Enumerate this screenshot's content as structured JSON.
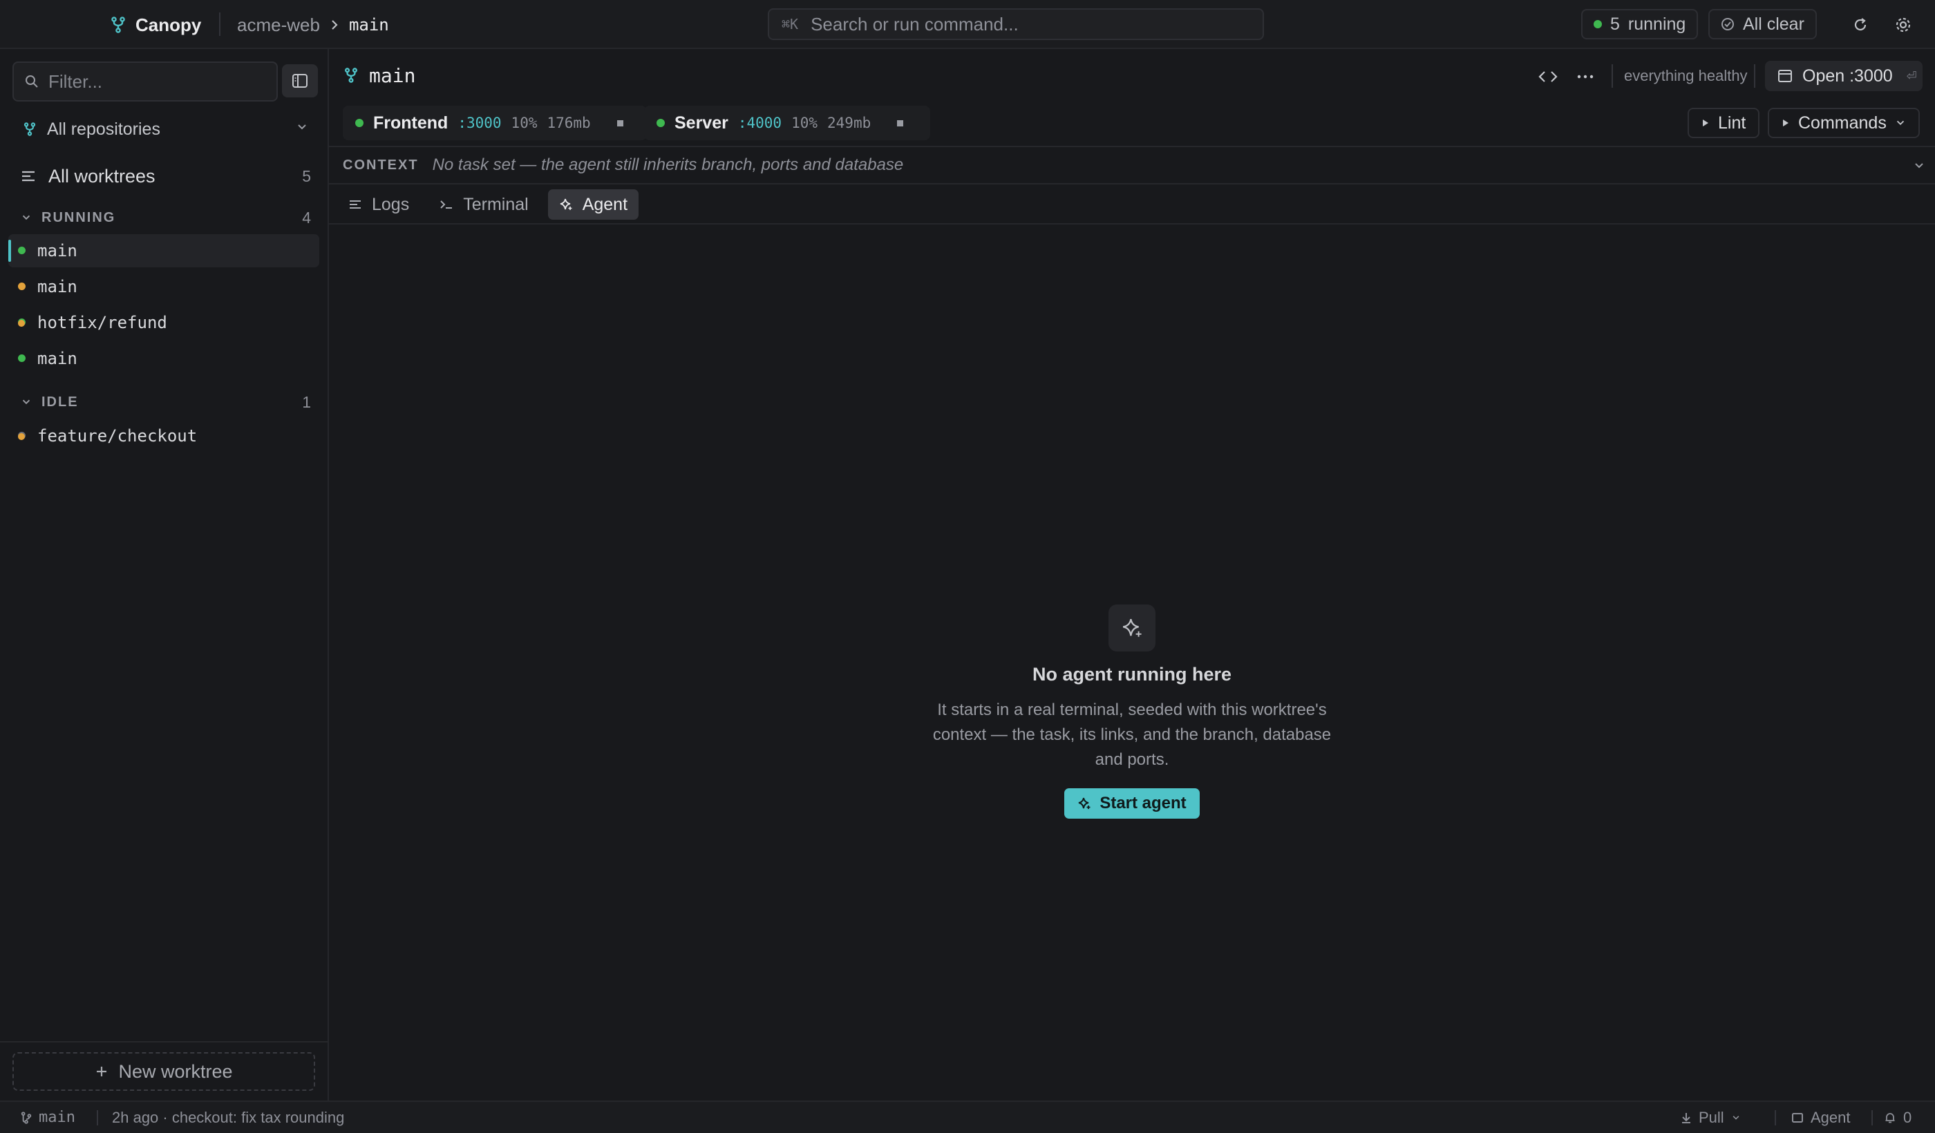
{
  "app": {
    "name": "Canopy",
    "repo": "acme-web",
    "branch": "main"
  },
  "search": {
    "shortcut": "⌘K",
    "placeholder": "Search or run command..."
  },
  "status_pills": {
    "running_count": "5",
    "running_label": "running",
    "all_clear": "All clear"
  },
  "sidebar": {
    "filter_placeholder": "Filter...",
    "repo_selector": "All repositories",
    "all_worktrees": {
      "label": "All worktrees",
      "count": "5"
    },
    "groups": [
      {
        "label": "RUNNING",
        "count": "4",
        "items": [
          {
            "name": "main",
            "status": "green",
            "active": true,
            "dirty": false
          },
          {
            "name": "main",
            "status": "orange",
            "active": false,
            "dirty": false
          },
          {
            "name": "hotfix/refund",
            "status": "green",
            "active": false,
            "dirty": true
          },
          {
            "name": "main",
            "status": "green",
            "active": false,
            "dirty": false
          }
        ]
      },
      {
        "label": "IDLE",
        "count": "1",
        "items": [
          {
            "name": "feature/checkout",
            "status": "gray",
            "active": false,
            "dirty": true
          }
        ]
      }
    ],
    "new_worktree": "New worktree"
  },
  "main": {
    "title": "main",
    "health": "everything healthy",
    "open_button": "Open :3000",
    "open_hint": "⏎",
    "services": [
      {
        "name": "Frontend",
        "port": ":3000",
        "cpu": "10%",
        "mem": "176mb"
      },
      {
        "name": "Server",
        "port": ":4000",
        "cpu": "10%",
        "mem": "249mb"
      }
    ],
    "lint_button": "Lint",
    "commands_button": "Commands",
    "context": {
      "label": "CONTEXT",
      "text": "No task set — the agent still inherits branch, ports and database"
    },
    "tabs": [
      {
        "label": "Logs",
        "icon": "lines-icon"
      },
      {
        "label": "Terminal",
        "icon": "terminal-icon"
      },
      {
        "label": "Agent",
        "icon": "sparkle-icon",
        "active": true
      }
    ],
    "empty_state": {
      "icon": "sparkle-icon",
      "title": "No agent running here",
      "description": "It starts in a real terminal, seeded with this worktree's context — the task, its links, and the branch, database and ports.",
      "button": "Start agent"
    }
  },
  "statusbar": {
    "branch": "main",
    "last_commit": "2h ago · checkout: fix tax rounding",
    "pull": "Pull",
    "agent": "Agent",
    "notifications": "0"
  },
  "colors": {
    "accent": "#4fc3c8",
    "running": "#3fb950",
    "warning": "#e3a23b",
    "idle": "#6b6d73",
    "background": "#18191c"
  }
}
